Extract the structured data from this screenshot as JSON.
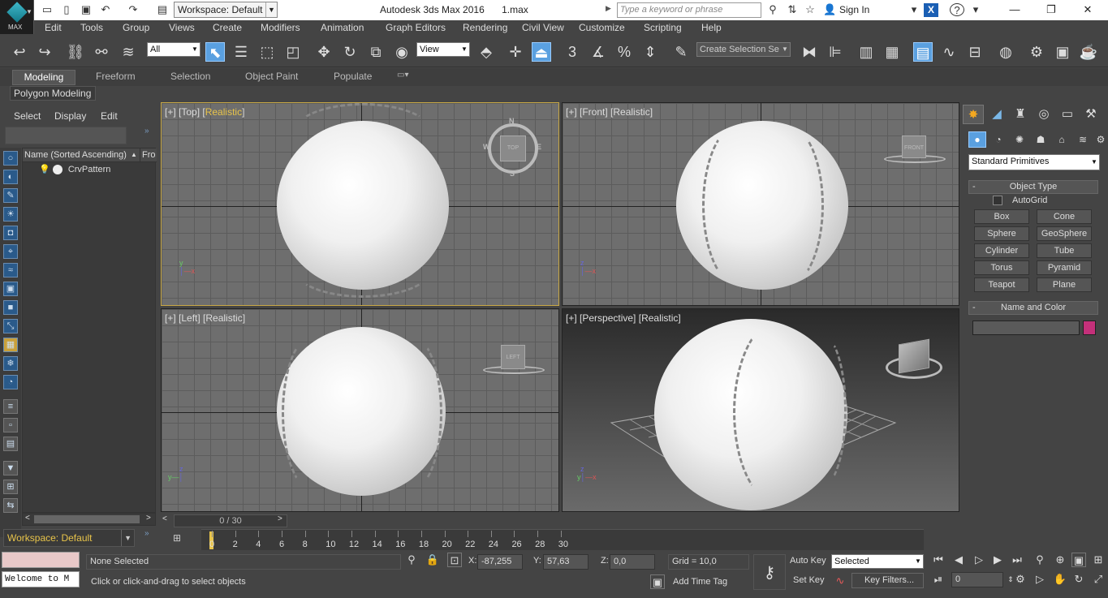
{
  "titlebar": {
    "app_button_label": "MAX",
    "workspace": "Workspace: Default",
    "title": "Autodesk 3ds Max 2016",
    "filename": "1.max",
    "search_placeholder": "Type a keyword or phrase",
    "sign_in": "Sign In"
  },
  "menubar": {
    "items": [
      "Edit",
      "Tools",
      "Group",
      "Views",
      "Create",
      "Modifiers",
      "Animation",
      "Graph Editors",
      "Rendering",
      "Civil View",
      "Customize",
      "Scripting",
      "Help"
    ]
  },
  "toolbar": {
    "selection_filter": "All",
    "reference_coord": "View",
    "snap_label": "3",
    "selection_set_placeholder": "Create Selection Se"
  },
  "ribbon": {
    "tabs": [
      "Modeling",
      "Freeform",
      "Selection",
      "Object Paint",
      "Populate"
    ],
    "panel": "Polygon Modeling"
  },
  "scene_explorer": {
    "menus": [
      "Select",
      "Display",
      "Edit"
    ],
    "column_name": "Name (Sorted Ascending)",
    "column_frozen": "Fro",
    "objects": [
      "CrvPattern"
    ],
    "workspace": "Workspace: Default"
  },
  "viewports": {
    "top": {
      "view": "Top",
      "shading": "Realistic",
      "cube_label": "TOP",
      "compass": {
        "n": "N",
        "s": "S",
        "e": "E",
        "w": "W"
      }
    },
    "front": {
      "view": "Front",
      "shading": "Realistic",
      "cube_label": "FRONT"
    },
    "left": {
      "view": "Left",
      "shading": "Realistic",
      "cube_label": "LEFT"
    },
    "perspective": {
      "view": "Perspective",
      "shading": "Realistic"
    }
  },
  "command_panel": {
    "category": "Standard Primitives",
    "object_type_title": "Object Type",
    "autogrid": "AutoGrid",
    "buttons": [
      "Box",
      "Cone",
      "Sphere",
      "GeoSphere",
      "Cylinder",
      "Tube",
      "Torus",
      "Pyramid",
      "Teapot",
      "Plane"
    ],
    "name_color_title": "Name and Color",
    "name_value": "",
    "object_color": "#c4307a"
  },
  "timeline": {
    "frame_counter": "0 / 30",
    "ticks": [
      "0",
      "2",
      "4",
      "6",
      "8",
      "10",
      "12",
      "14",
      "16",
      "18",
      "20",
      "22",
      "24",
      "26",
      "28",
      "30"
    ]
  },
  "statusbar": {
    "maxscript_listener": "Welcome to M",
    "selection_status": "None Selected",
    "prompt": "Click or click-and-drag to select objects",
    "x_label": "X:",
    "x_value": "-87,255",
    "y_label": "Y:",
    "y_value": "57,63",
    "z_label": "Z:",
    "z_value": "0,0",
    "grid": "Grid = 10,0",
    "add_time_tag": "Add Time Tag",
    "auto_key": "Auto Key",
    "set_key": "Set Key",
    "key_mode": "Selected",
    "key_filters": "Key Filters...",
    "current_frame": "0"
  },
  "colors": {
    "active_viewport_border": "#c8a846",
    "highlight_text": "#e8c44a",
    "selected_tool": "#5aa0e0"
  }
}
